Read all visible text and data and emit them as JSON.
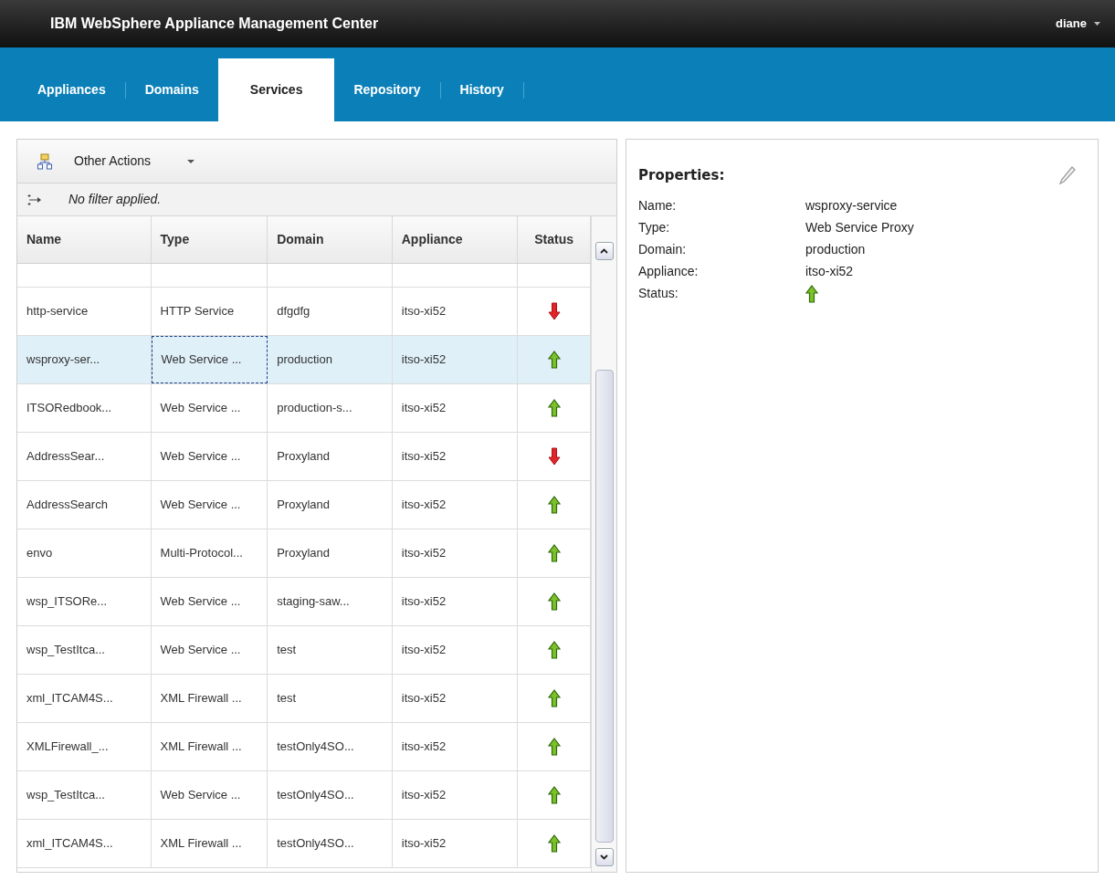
{
  "app": {
    "title": "IBM WebSphere Appliance Management Center",
    "user": "diane"
  },
  "tabs": [
    {
      "label": "Appliances",
      "selected": false
    },
    {
      "label": "Domains",
      "selected": false
    },
    {
      "label": "Services",
      "selected": true
    },
    {
      "label": "Repository",
      "selected": false
    },
    {
      "label": "History",
      "selected": false
    }
  ],
  "toolbar": {
    "menu": "Other Actions"
  },
  "filter": {
    "text": "No filter applied."
  },
  "table": {
    "columns": [
      "Name",
      "Type",
      "Domain",
      "Appliance",
      "Status"
    ],
    "rows": [
      {
        "name": "http-service",
        "type": "HTTP Service",
        "domain": "dfgdfg",
        "appliance": "itso-xi52",
        "kind": "down",
        "selected": false,
        "focused": false
      },
      {
        "name": "wsproxy-ser...",
        "type": "Web Service ...",
        "domain": "production",
        "appliance": "itso-xi52",
        "kind": "up",
        "selected": true,
        "focused": true
      },
      {
        "name": "ITSORedbook...",
        "type": "Web Service ...",
        "domain": "production-s...",
        "appliance": "itso-xi52",
        "kind": "up",
        "selected": false,
        "focused": false
      },
      {
        "name": "AddressSear...",
        "type": "Web Service ...",
        "domain": "Proxyland",
        "appliance": "itso-xi52",
        "kind": "down",
        "selected": false,
        "focused": false
      },
      {
        "name": "AddressSearch",
        "type": "Web Service ...",
        "domain": "Proxyland",
        "appliance": "itso-xi52",
        "kind": "up",
        "selected": false,
        "focused": false
      },
      {
        "name": "envo",
        "type": "Multi-Protocol...",
        "domain": "Proxyland",
        "appliance": "itso-xi52",
        "kind": "up",
        "selected": false,
        "focused": false
      },
      {
        "name": "wsp_ITSORe...",
        "type": "Web Service ...",
        "domain": "staging-saw...",
        "appliance": "itso-xi52",
        "kind": "up",
        "selected": false,
        "focused": false
      },
      {
        "name": "wsp_TestItca...",
        "type": "Web Service ...",
        "domain": "test",
        "appliance": "itso-xi52",
        "kind": "up",
        "selected": false,
        "focused": false
      },
      {
        "name": "xml_ITCAM4S...",
        "type": "XML Firewall ...",
        "domain": "test",
        "appliance": "itso-xi52",
        "kind": "up",
        "selected": false,
        "focused": false
      },
      {
        "name": "XMLFirewall_...",
        "type": "XML Firewall ...",
        "domain": "testOnly4SO...",
        "appliance": "itso-xi52",
        "kind": "up",
        "selected": false,
        "focused": false
      },
      {
        "name": "wsp_TestItca...",
        "type": "Web Service ...",
        "domain": "testOnly4SO...",
        "appliance": "itso-xi52",
        "kind": "up",
        "selected": false,
        "focused": false
      },
      {
        "name": "xml_ITCAM4S...",
        "type": "XML Firewall ...",
        "domain": "testOnly4SO...",
        "appliance": "itso-xi52",
        "kind": "up",
        "selected": false,
        "focused": false
      }
    ]
  },
  "properties": {
    "title": "Properties:",
    "items": [
      {
        "label": "Name:",
        "kind": "text",
        "value": "wsproxy-service"
      },
      {
        "label": "Type:",
        "kind": "text",
        "value": "Web Service Proxy"
      },
      {
        "label": "Domain:",
        "kind": "text",
        "value": "production"
      },
      {
        "label": "Appliance:",
        "kind": "text",
        "value": "itso-xi52"
      },
      {
        "label": "Status:",
        "kind": "status-up"
      }
    ]
  }
}
